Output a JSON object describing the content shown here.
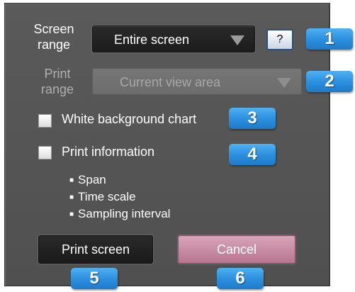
{
  "screen_range": {
    "label": "Screen\nrange",
    "label_line1": "Screen",
    "label_line2": "range",
    "selected": "Entire screen",
    "help_label": "?"
  },
  "print_range": {
    "label_line1": "Print",
    "label_line2": "range",
    "selected": "Current view area"
  },
  "white_background": {
    "label": "White background chart",
    "checked": false
  },
  "print_information": {
    "label": "Print information",
    "checked": false,
    "items": [
      "Span",
      "Time scale",
      "Sampling interval"
    ]
  },
  "buttons": {
    "print": "Print screen",
    "cancel": "Cancel"
  },
  "badges": [
    "1",
    "2",
    "3",
    "4",
    "5",
    "6"
  ],
  "colors": {
    "badge": "#2a8ede",
    "panel": "#555555",
    "cancel": "#c98aa2"
  }
}
